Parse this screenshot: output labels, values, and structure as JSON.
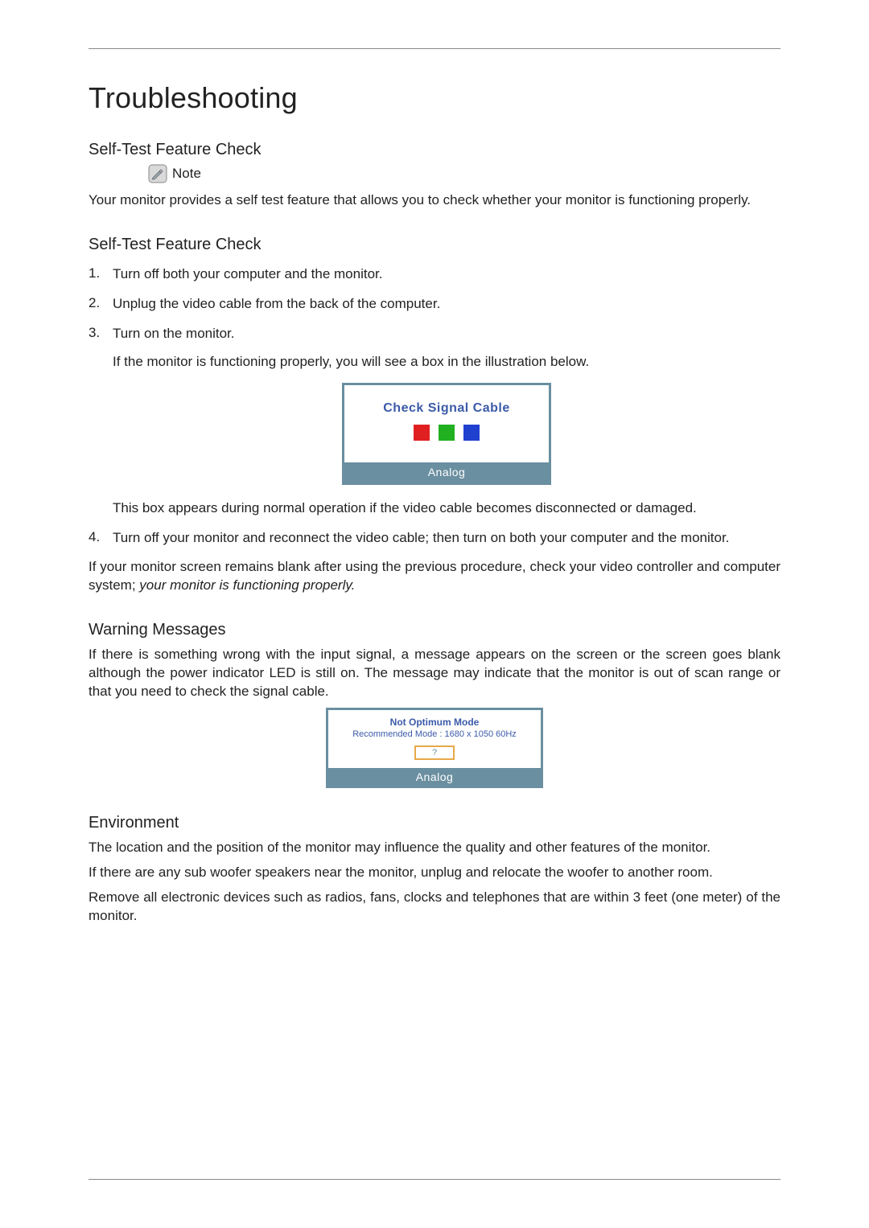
{
  "title": "Troubleshooting",
  "sections": {
    "selftest1": {
      "heading": "Self-Test Feature Check",
      "note_label": "Note",
      "note_body": "Your monitor provides a self test feature that allows you to check whether your monitor is functioning properly."
    },
    "selftest2": {
      "heading": "Self-Test Feature Check",
      "steps": [
        {
          "num": "1.",
          "text": "Turn off both your computer and the monitor."
        },
        {
          "num": "2.",
          "text": "Unplug the video cable from the back of the computer."
        },
        {
          "num": "3.",
          "text": "Turn on the monitor."
        },
        {
          "num": "4.",
          "text": "Turn off your monitor and reconnect the video cable; then turn on both your computer and the monitor."
        }
      ],
      "step3_sub1": "If the monitor is functioning properly, you will see a box in the illustration below.",
      "step3_sub2": "This box appears during normal operation if the video cable becomes disconnected or damaged.",
      "closing_plain": "If your monitor screen remains blank after using the previous procedure, check your video controller and computer system; ",
      "closing_italic": "your monitor is functioning properly."
    },
    "warning": {
      "heading": "Warning Messages",
      "body": "If there is something wrong with the input signal, a message appears on the screen or the screen goes blank although the power indicator LED is still on. The message may indicate that the monitor is out of scan range or that you need to check the signal cable."
    },
    "environment": {
      "heading": "Environment",
      "p1": "The location and the position of the monitor may influence the quality and other features of the monitor.",
      "p2": "If there are any sub woofer speakers near the monitor, unplug and relocate the woofer to another room.",
      "p3": "Remove all electronic devices such as radios, fans, clocks and telephones that are within 3 feet (one meter) of the monitor."
    }
  },
  "illustration1": {
    "title": "Check Signal Cable",
    "footer": "Analog"
  },
  "illustration2": {
    "line1": "Not Optimum Mode",
    "line2": "Recommended Mode : 1680 x  1050 60Hz",
    "button": "?",
    "footer": "Analog"
  }
}
